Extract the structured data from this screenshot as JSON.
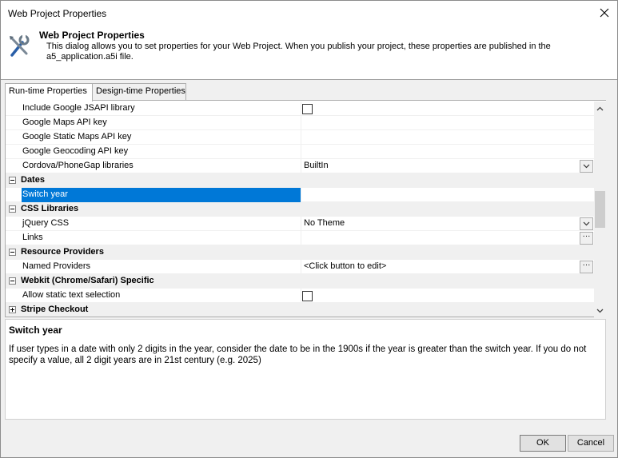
{
  "window": {
    "title": "Web Project Properties"
  },
  "header": {
    "title": "Web Project Properties",
    "description": "This dialog allows you to set properties for your Web Project. When you publish your project, these properties are published in the a5_application.a5i file.",
    "icon": "tools-icon"
  },
  "tabs": [
    {
      "label": "Run-time Properties",
      "active": true
    },
    {
      "label": "Design-time Properties",
      "active": false
    }
  ],
  "grid": {
    "rows": [
      {
        "type": "prop",
        "name": "Include Google JSAPI library",
        "value": "",
        "editor": "checkbox"
      },
      {
        "type": "prop",
        "name": "Google Maps API key",
        "value": "",
        "editor": "text"
      },
      {
        "type": "prop",
        "name": "Google Static Maps API key",
        "value": "",
        "editor": "text"
      },
      {
        "type": "prop",
        "name": "Google Geocoding API key",
        "value": "",
        "editor": "text"
      },
      {
        "type": "prop",
        "name": "Cordova/PhoneGap libraries",
        "value": "BuiltIn",
        "editor": "dropdown"
      },
      {
        "type": "cat",
        "name": "Dates",
        "expanded": true
      },
      {
        "type": "prop",
        "name": "Switch year",
        "value": "",
        "editor": "text",
        "selected": true
      },
      {
        "type": "cat",
        "name": "CSS Libraries",
        "expanded": true
      },
      {
        "type": "prop",
        "name": "jQuery CSS",
        "value": "No Theme",
        "editor": "dropdown"
      },
      {
        "type": "prop",
        "name": "Links",
        "value": "",
        "editor": "ellipsis"
      },
      {
        "type": "cat",
        "name": "Resource Providers",
        "expanded": true
      },
      {
        "type": "prop",
        "name": "Named Providers",
        "value": "<Click button to edit>",
        "editor": "ellipsis"
      },
      {
        "type": "cat",
        "name": "Webkit (Chrome/Safari) Specific",
        "expanded": true
      },
      {
        "type": "prop",
        "name": "Allow static text selection",
        "value": "",
        "editor": "checkbox"
      },
      {
        "type": "cat",
        "name": "Stripe Checkout",
        "expanded": false
      }
    ]
  },
  "description_panel": {
    "title": "Switch year",
    "text": "If user types in a date with only 2 digits in the year, consider the date to be in the 1900s if the year is greater than the switch year. If you do not specify a value, all 2 digit years are in 21st century (e.g. 2025)"
  },
  "buttons": {
    "ok": "OK",
    "cancel": "Cancel"
  },
  "colors": {
    "selection": "#0078d7",
    "category_bg": "#f0f0f0"
  }
}
